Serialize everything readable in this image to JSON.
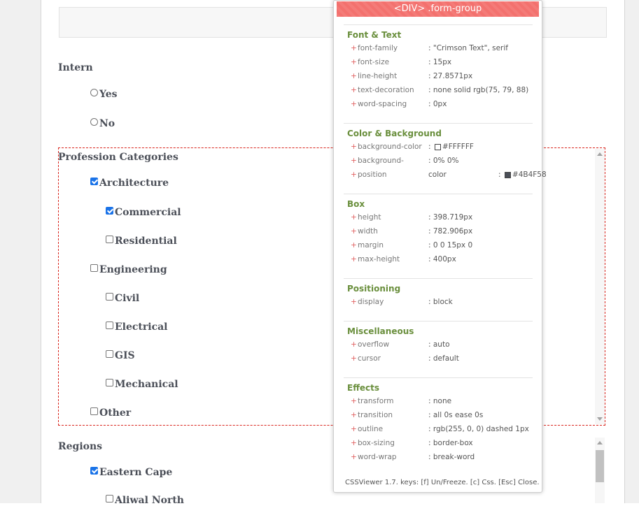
{
  "form": {
    "intern_label": "Intern",
    "intern_options": [
      "Yes",
      "No"
    ],
    "profession_label": "Profession Categories",
    "professions": [
      {
        "label": "Architecture",
        "checked": true
      },
      {
        "label": "Commercial",
        "checked": true
      },
      {
        "label": "Residential",
        "checked": false
      },
      {
        "label": "Engineering",
        "checked": false
      },
      {
        "label": "Civil",
        "checked": false
      },
      {
        "label": "Electrical",
        "checked": false
      },
      {
        "label": "GIS",
        "checked": false
      },
      {
        "label": "Mechanical",
        "checked": false
      },
      {
        "label": "Other",
        "checked": false
      }
    ],
    "regions_label": "Regions",
    "regions": [
      {
        "label": "Eastern Cape",
        "checked": true
      },
      {
        "label": "Aliwal North",
        "checked": false
      }
    ]
  },
  "viewer": {
    "title": "<DIV> .form-group",
    "sections": [
      {
        "head": "Font & Text",
        "rows": [
          {
            "k": "font-family",
            "v": ": \"Crimson Text\", serif"
          },
          {
            "k": "font-size",
            "v": ": 15px"
          },
          {
            "k": "line-height",
            "v": ": 27.8571px"
          },
          {
            "k": "text-decoration",
            "v": ": none solid rgb(75, 79, 88)"
          },
          {
            "k": "word-spacing",
            "v": ": 0px"
          }
        ]
      },
      {
        "head": "Color & Background",
        "rows": [
          {
            "k": "background-color",
            "v": "#FFFFFF"
          },
          {
            "k": "background-",
            "v": ": 0% 0%"
          },
          {
            "k": "position",
            "v": "color"
          },
          {
            "k": "",
            "v": "#4B4F58"
          }
        ]
      },
      {
        "head": "Box",
        "rows": [
          {
            "k": "height",
            "v": ": 398.719px"
          },
          {
            "k": "width",
            "v": ": 782.906px"
          },
          {
            "k": "margin",
            "v": ": 0 0 15px 0"
          },
          {
            "k": "max-height",
            "v": ": 400px"
          }
        ]
      },
      {
        "head": "Positioning",
        "rows": [
          {
            "k": "display",
            "v": ": block"
          }
        ]
      },
      {
        "head": "Miscellaneous",
        "rows": [
          {
            "k": "overflow",
            "v": ": auto"
          },
          {
            "k": "cursor",
            "v": ": default"
          }
        ]
      },
      {
        "head": "Effects",
        "rows": [
          {
            "k": "transform",
            "v": ": none"
          },
          {
            "k": "transition",
            "v": ": all 0s ease 0s"
          },
          {
            "k": "outline",
            "v": ": rgb(255, 0, 0) dashed 1px"
          },
          {
            "k": "box-sizing",
            "v": ": border-box"
          },
          {
            "k": "word-wrap",
            "v": ": break-word"
          }
        ]
      }
    ],
    "footer": "CSSViewer 1.7. keys: [f] Un/Freeze. [c] Css. [Esc] Close."
  },
  "colors": {
    "accent": "#1a73e8",
    "outline": "#d9251d",
    "viewer_header": "#f47b78",
    "section_head": "#6a8f3d"
  }
}
